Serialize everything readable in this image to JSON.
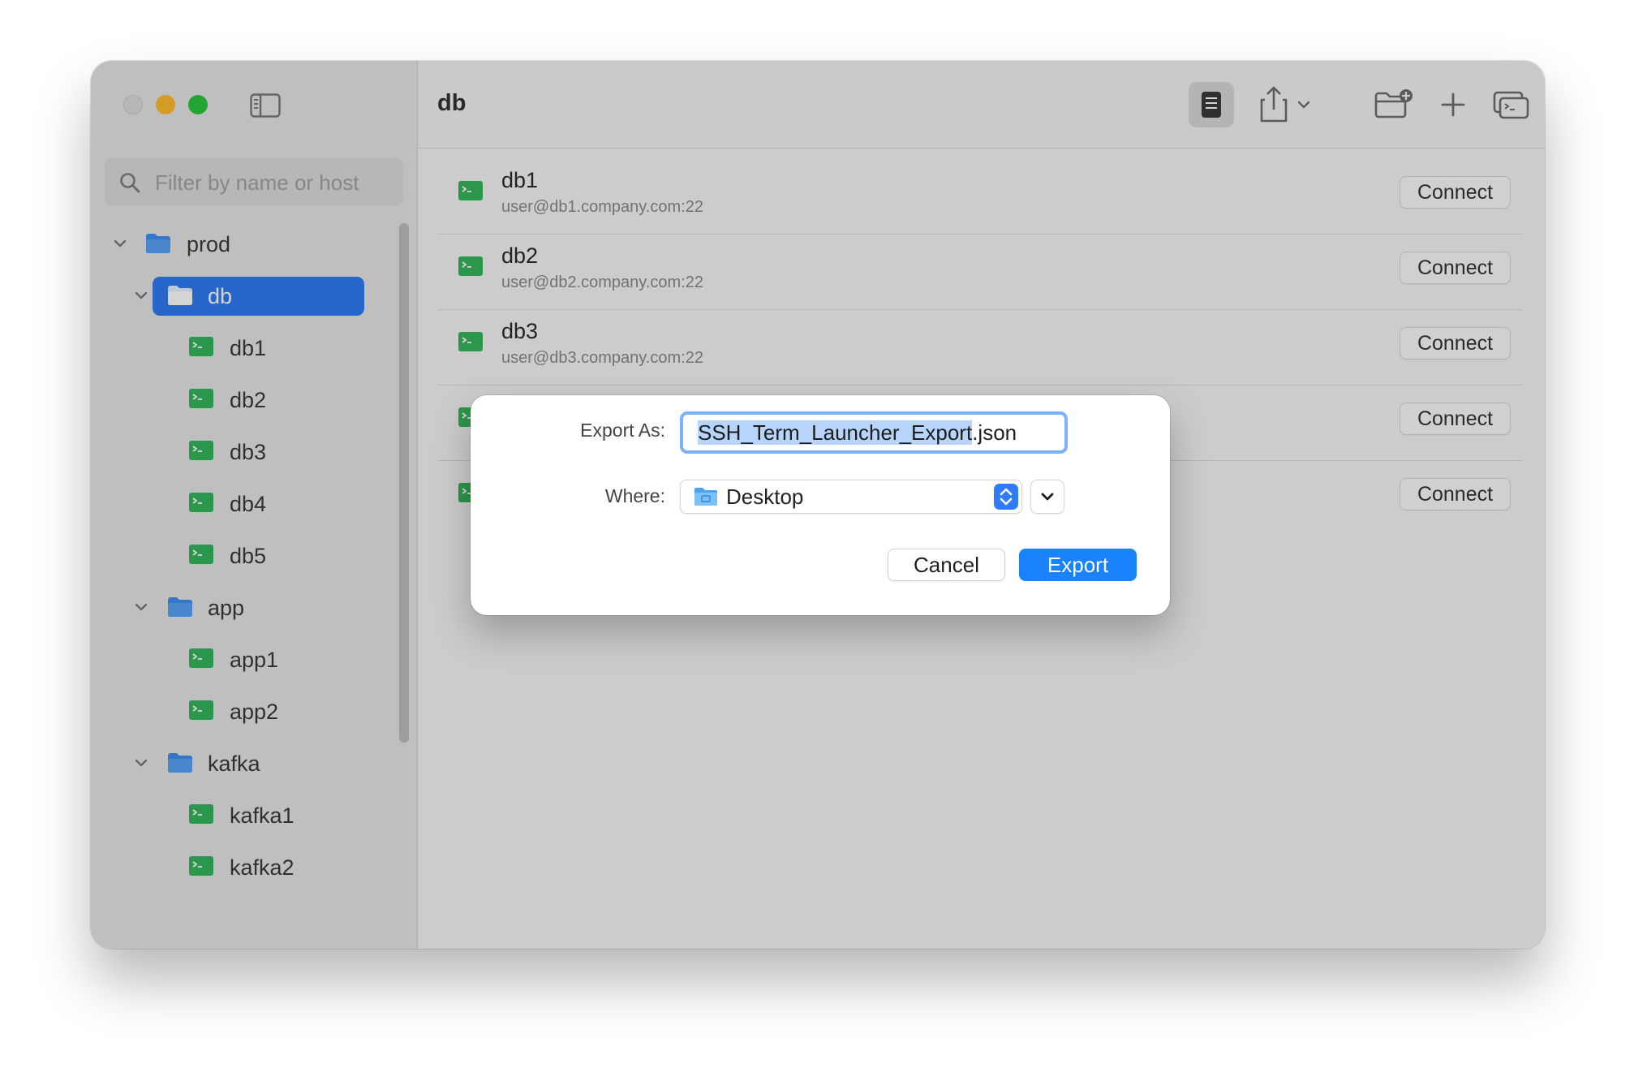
{
  "window": {
    "sidebar": {
      "search_placeholder": "Filter by name or host",
      "tree": {
        "prod": "prod",
        "db": "db",
        "db_items": [
          "db1",
          "db2",
          "db3",
          "db4",
          "db5"
        ],
        "app": "app",
        "app_items": [
          "app1",
          "app2"
        ],
        "kafka": "kafka",
        "kafka_items": [
          "kafka1",
          "kafka2"
        ]
      }
    },
    "toolbar": {
      "title": "db"
    },
    "hosts": [
      {
        "name": "db1",
        "address": "user@db1.company.com:22",
        "connect": "Connect"
      },
      {
        "name": "db2",
        "address": "user@db2.company.com:22",
        "connect": "Connect"
      },
      {
        "name": "db3",
        "address": "user@db3.company.com:22",
        "connect": "Connect"
      },
      {
        "connect": "Connect"
      },
      {
        "connect": "Connect"
      }
    ]
  },
  "dialog": {
    "export_as_label": "Export As:",
    "filename_selected": "SSH_Term_Launcher_Export",
    "filename_extension": ".json",
    "where_label": "Where:",
    "where_value": "Desktop",
    "cancel_label": "Cancel",
    "export_label": "Export"
  },
  "colors": {
    "accent": "#1a82fb",
    "selection": "#2f7cf6",
    "folder": "#3f8ef2",
    "terminal": "#34b65a"
  }
}
